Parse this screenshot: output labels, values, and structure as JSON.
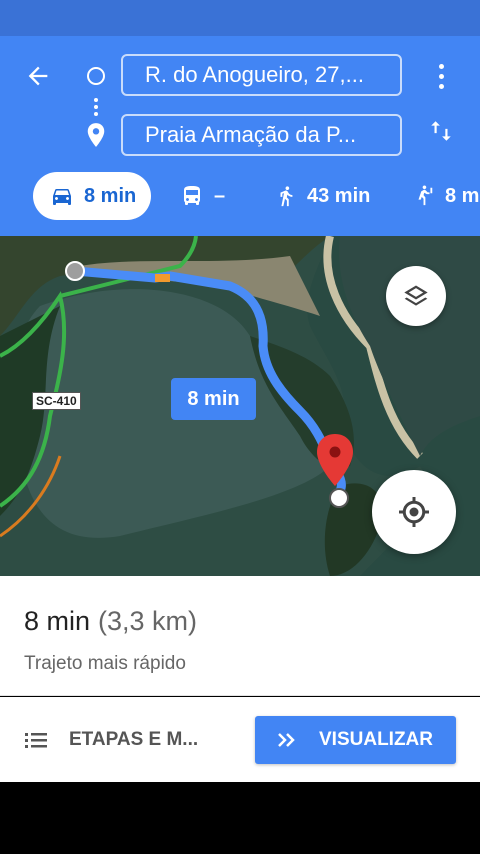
{
  "header": {
    "origin": "R. do Anogueiro, 27,...",
    "destination": "Praia Armação da P..."
  },
  "modes": [
    {
      "label": "8 min",
      "icon": "car-icon",
      "active": true
    },
    {
      "label": "–",
      "icon": "bus-icon",
      "active": false
    },
    {
      "label": "43 min",
      "icon": "walk-icon",
      "active": false
    },
    {
      "label": "8 m",
      "icon": "ride-icon",
      "active": false
    }
  ],
  "map": {
    "road_label": "SC-410",
    "route_duration": "8 min"
  },
  "route": {
    "time": "8 min",
    "distance": "(3,3 km)",
    "description": "Trajeto mais rápido"
  },
  "actions": {
    "steps_label": "ETAPAS E M...",
    "preview_label": "VISUALIZAR"
  },
  "colors": {
    "primary": "#4285f4",
    "status_bar": "#3a72d6",
    "route_line": "#4a8cf7",
    "destination_pin": "#e53935"
  }
}
